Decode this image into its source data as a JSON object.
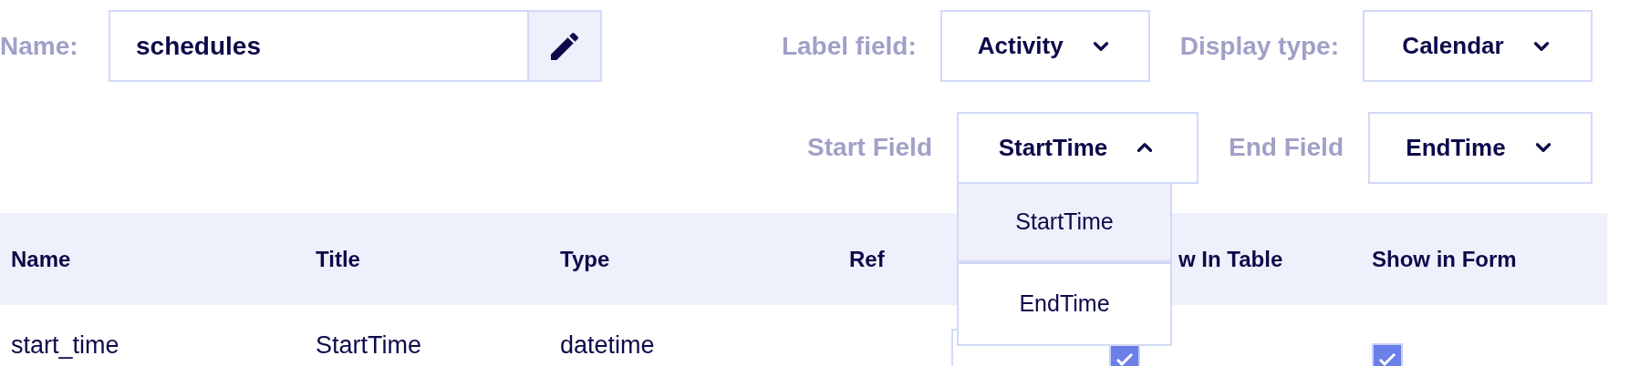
{
  "name_field": {
    "label": "Name:",
    "value": "schedules"
  },
  "selects": [
    {
      "label": "Label field:",
      "value": "Activity",
      "expanded": false
    },
    {
      "label": "Display type:",
      "value": "Calendar",
      "expanded": false
    }
  ],
  "range_selects": [
    {
      "label": "Start Field",
      "value": "StartTime",
      "expanded": true,
      "options": [
        {
          "label": "StartTime",
          "selected": true
        },
        {
          "label": "EndTime",
          "selected": false
        }
      ]
    },
    {
      "label": "End Field",
      "value": "EndTime",
      "expanded": false
    }
  ],
  "table": {
    "columns": [
      "Name",
      "Title",
      "Type",
      "Ref",
      "w In Table",
      "Show in Form"
    ],
    "rows": [
      {
        "cells": [
          "start_time",
          "StartTime",
          "datetime"
        ],
        "show_in_table": true,
        "show_in_form": true
      }
    ]
  }
}
